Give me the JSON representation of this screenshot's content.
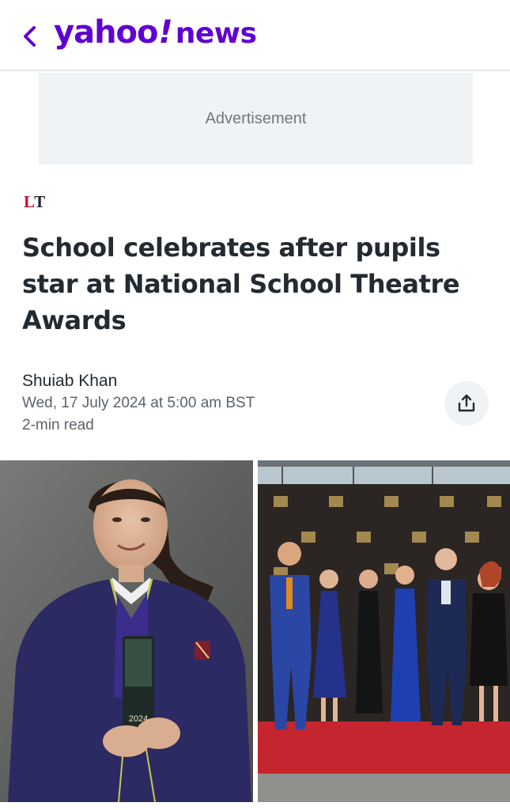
{
  "header": {
    "logo_main": "yahoo",
    "logo_bang": "!",
    "logo_suffix": "news",
    "back_icon": "chevron-left-icon",
    "brand_color": "#6001d2"
  },
  "ad": {
    "label": "Advertisement"
  },
  "publisher": {
    "logo_l": "L",
    "logo_t": "T",
    "accent": "#c8102e"
  },
  "article": {
    "title": "School celebrates after pupils star at National School Theatre Awards",
    "author": "Shuiab Khan",
    "date": "Wed, 17 July 2024 at 5:00 am BST",
    "read_time": "2-min read",
    "share_icon": "share-icon"
  },
  "images": {
    "left_award_year": "2024"
  }
}
